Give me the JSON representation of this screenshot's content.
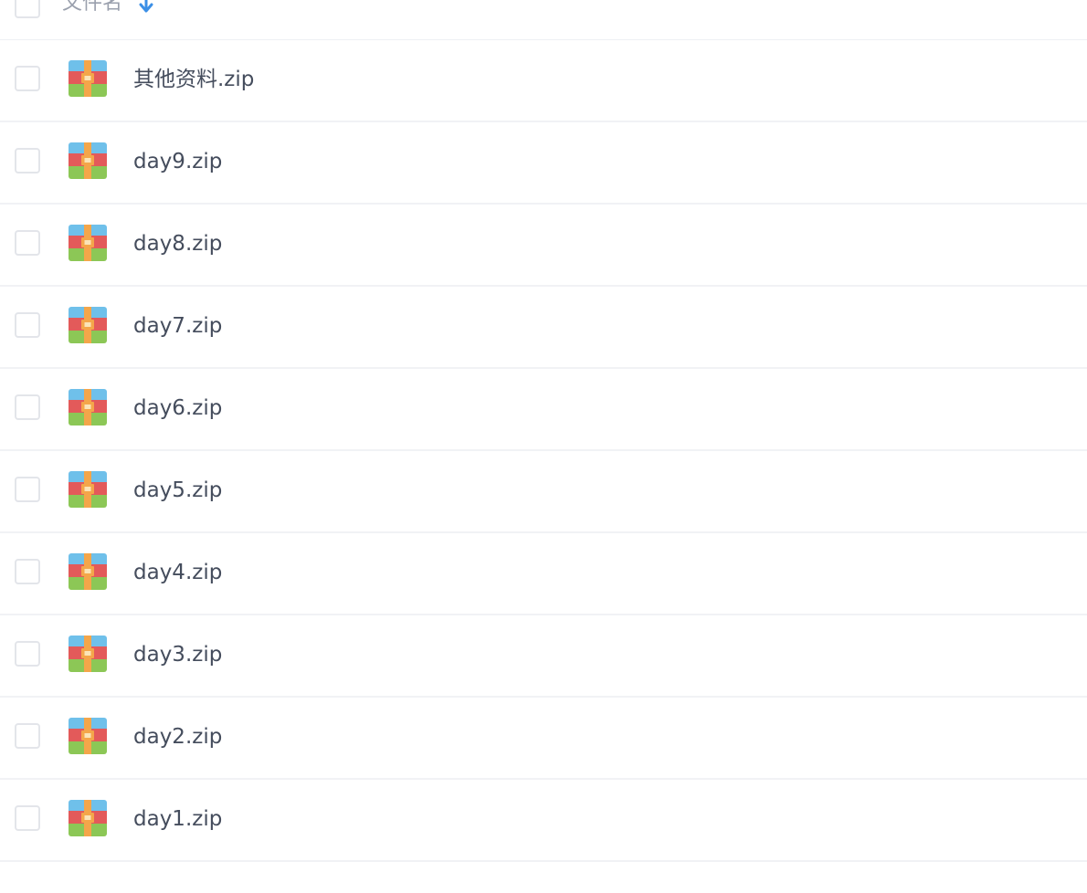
{
  "header": {
    "column_label": "文件名",
    "sort_icon": "arrow-down-icon",
    "sort_color": "#3b8fe6"
  },
  "file_icon": {
    "name": "zip-archive-icon",
    "colors": {
      "top": "#6fc0ea",
      "middle": "#e35a5a",
      "bottom": "#8cc756",
      "strap": "#f4a64a",
      "buckle": "#fbe4b8"
    }
  },
  "files": [
    {
      "name": "其他资料.zip"
    },
    {
      "name": "day9.zip"
    },
    {
      "name": "day8.zip"
    },
    {
      "name": "day7.zip"
    },
    {
      "name": "day6.zip"
    },
    {
      "name": "day5.zip"
    },
    {
      "name": "day4.zip"
    },
    {
      "name": "day3.zip"
    },
    {
      "name": "day2.zip"
    },
    {
      "name": "day1.zip"
    }
  ]
}
